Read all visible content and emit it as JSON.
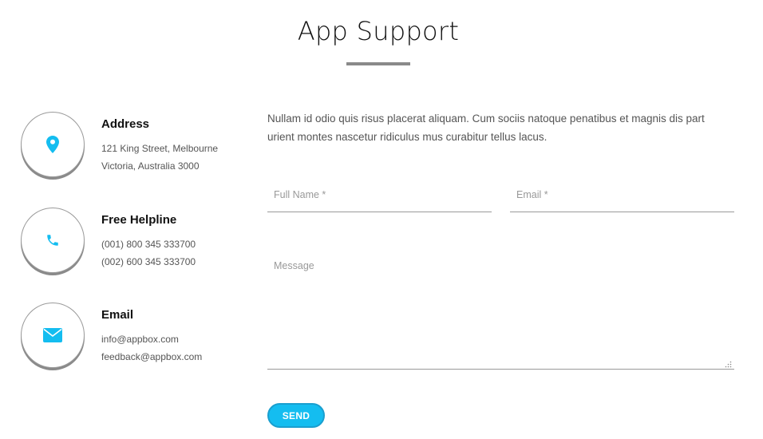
{
  "header": {
    "title": "App Support"
  },
  "colors": {
    "accent": "#14bdf0",
    "rule": "#8a8a8a",
    "ring": "#8a8a8a"
  },
  "contact": {
    "address": {
      "icon": "location-pin-icon",
      "heading": "Address",
      "lines": [
        "121 King Street, Melbourne",
        "Victoria, Australia 3000"
      ]
    },
    "helpline": {
      "icon": "phone-icon",
      "heading": "Free Helpline",
      "lines": [
        "(001) 800 345 333700",
        "(002) 600 345 333700"
      ]
    },
    "email": {
      "icon": "envelope-icon",
      "heading": "Email",
      "lines": [
        "info@appbox.com",
        "feedback@appbox.com"
      ]
    }
  },
  "form": {
    "intro": "Nullam id odio quis risus placerat aliquam. Cum sociis natoque penatibus et magnis dis part urient montes nascetur ridiculus mus curabitur tellus lacus.",
    "full_name": {
      "placeholder": "Full Name *",
      "value": ""
    },
    "email": {
      "placeholder": "Email *",
      "value": ""
    },
    "message": {
      "placeholder": "Message",
      "value": ""
    },
    "send_label": "SEND"
  }
}
